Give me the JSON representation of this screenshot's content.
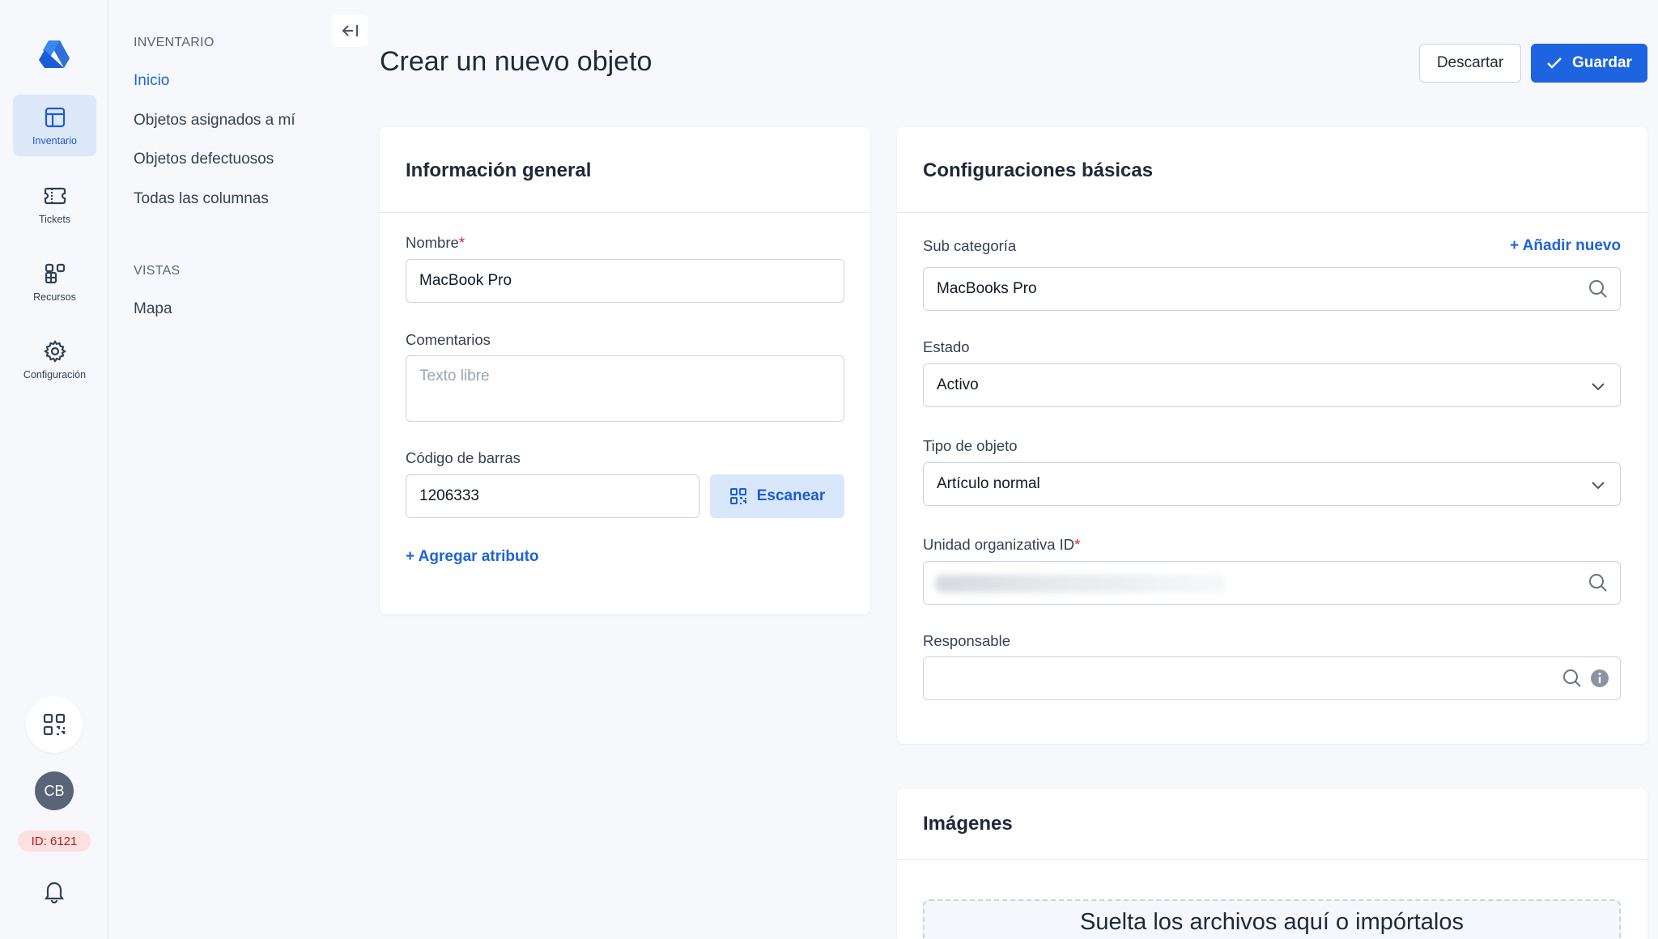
{
  "rail": {
    "items": [
      {
        "label": "Inventario",
        "icon": "table-icon",
        "active": true
      },
      {
        "label": "Tickets",
        "icon": "ticket-icon",
        "active": false
      },
      {
        "label": "Recursos",
        "icon": "apps-icon",
        "active": false
      },
      {
        "label": "Configuración",
        "icon": "gear-icon",
        "active": false
      }
    ],
    "avatar_initials": "CB",
    "id_badge": "ID: 6121"
  },
  "subnav": {
    "inventory_title": "INVENTARIO",
    "inventory_links": [
      "Inicio",
      "Objetos asignados a mí",
      "Objetos defectuosos",
      "Todas las columnas"
    ],
    "views_title": "VISTAS",
    "views_links": [
      "Mapa"
    ]
  },
  "header": {
    "title": "Crear un nuevo objeto",
    "discard_label": "Descartar",
    "save_label": "Guardar"
  },
  "general": {
    "title": "Información general",
    "name_label": "Nombre",
    "name_value": "MacBook Pro",
    "comments_label": "Comentarios",
    "comments_placeholder": "Texto libre",
    "barcode_label": "Código de barras",
    "barcode_value": "1206333",
    "scan_label": "Escanear",
    "add_attribute": "+ Agregar atributo"
  },
  "basic": {
    "title": "Configuraciones básicas",
    "subcategory_label": "Sub categoría",
    "add_new": "+ Añadir nuevo",
    "subcategory_value": "MacBooks Pro",
    "status_label": "Estado",
    "status_value": "Activo",
    "type_label": "Tipo de objeto",
    "type_value": "Artículo normal",
    "org_unit_label": "Unidad organizativa ID",
    "responsible_label": "Responsable"
  },
  "images": {
    "title": "Imágenes",
    "dropzone_text": "Suelta los archivos aquí o impórtalos"
  },
  "colors": {
    "accent": "#1e63e0",
    "required": "#e02424",
    "badge_bg": "#fde0e0"
  }
}
